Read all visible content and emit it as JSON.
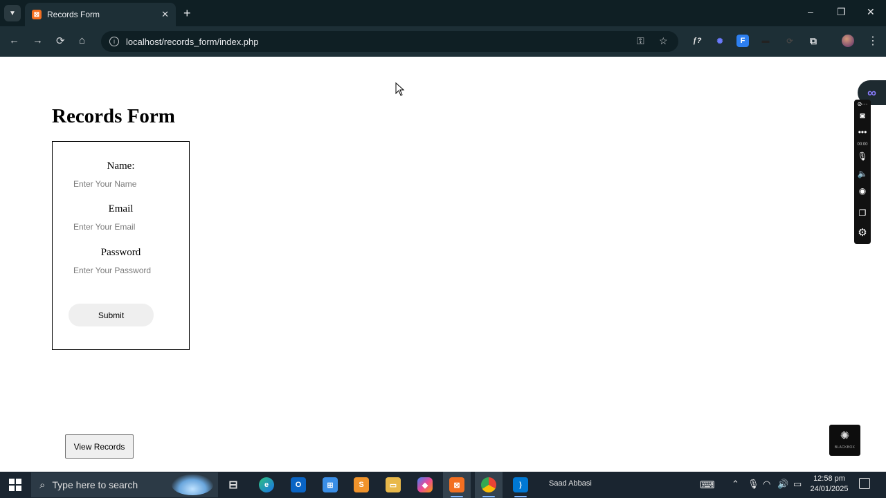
{
  "browser": {
    "tab_title": "Records Form",
    "tab_close": "✕",
    "new_tab": "+",
    "url": "localhost/records_form/index.php",
    "window_controls": {
      "minimize": "–",
      "restore": "❐",
      "close": "✕"
    },
    "nav": {
      "back": "←",
      "forward": "→",
      "reload": "⟳",
      "home": "⌂"
    },
    "extensions": [
      {
        "icon": "fx-extension-icon",
        "glyph": "ƒ?"
      },
      {
        "icon": "sparkle-extension-icon",
        "glyph": "✺"
      },
      {
        "icon": "blue-f-extension-icon",
        "glyph": "F"
      },
      {
        "icon": "dark-extension-icon",
        "glyph": "▬"
      },
      {
        "icon": "sync-extension-icon",
        "glyph": "⟳"
      },
      {
        "icon": "puzzle-extensions-icon",
        "glyph": "⧉"
      }
    ]
  },
  "page": {
    "title": "Records Form",
    "form": {
      "name_label": "Name:",
      "name_placeholder": "Enter Your Name",
      "email_label": "Email",
      "email_placeholder": "Enter Your Email",
      "password_label": "Password",
      "password_placeholder": "Enter Your Password",
      "submit_label": "Submit"
    },
    "view_records_label": "View Records"
  },
  "recorder": {
    "logo": "∞",
    "timer": "00:00",
    "blackbox_label": "BLACKBOX"
  },
  "taskbar": {
    "search_placeholder": "Type here to search",
    "user_name": "Saad Abbasi",
    "time": "12:58 pm",
    "date": "24/01/2025"
  },
  "colors": {
    "chrome_dark": "#0f1f24",
    "chrome_toolbar": "#1d2f36",
    "taskbar": "#1a2530",
    "button_bg": "#efefef"
  }
}
